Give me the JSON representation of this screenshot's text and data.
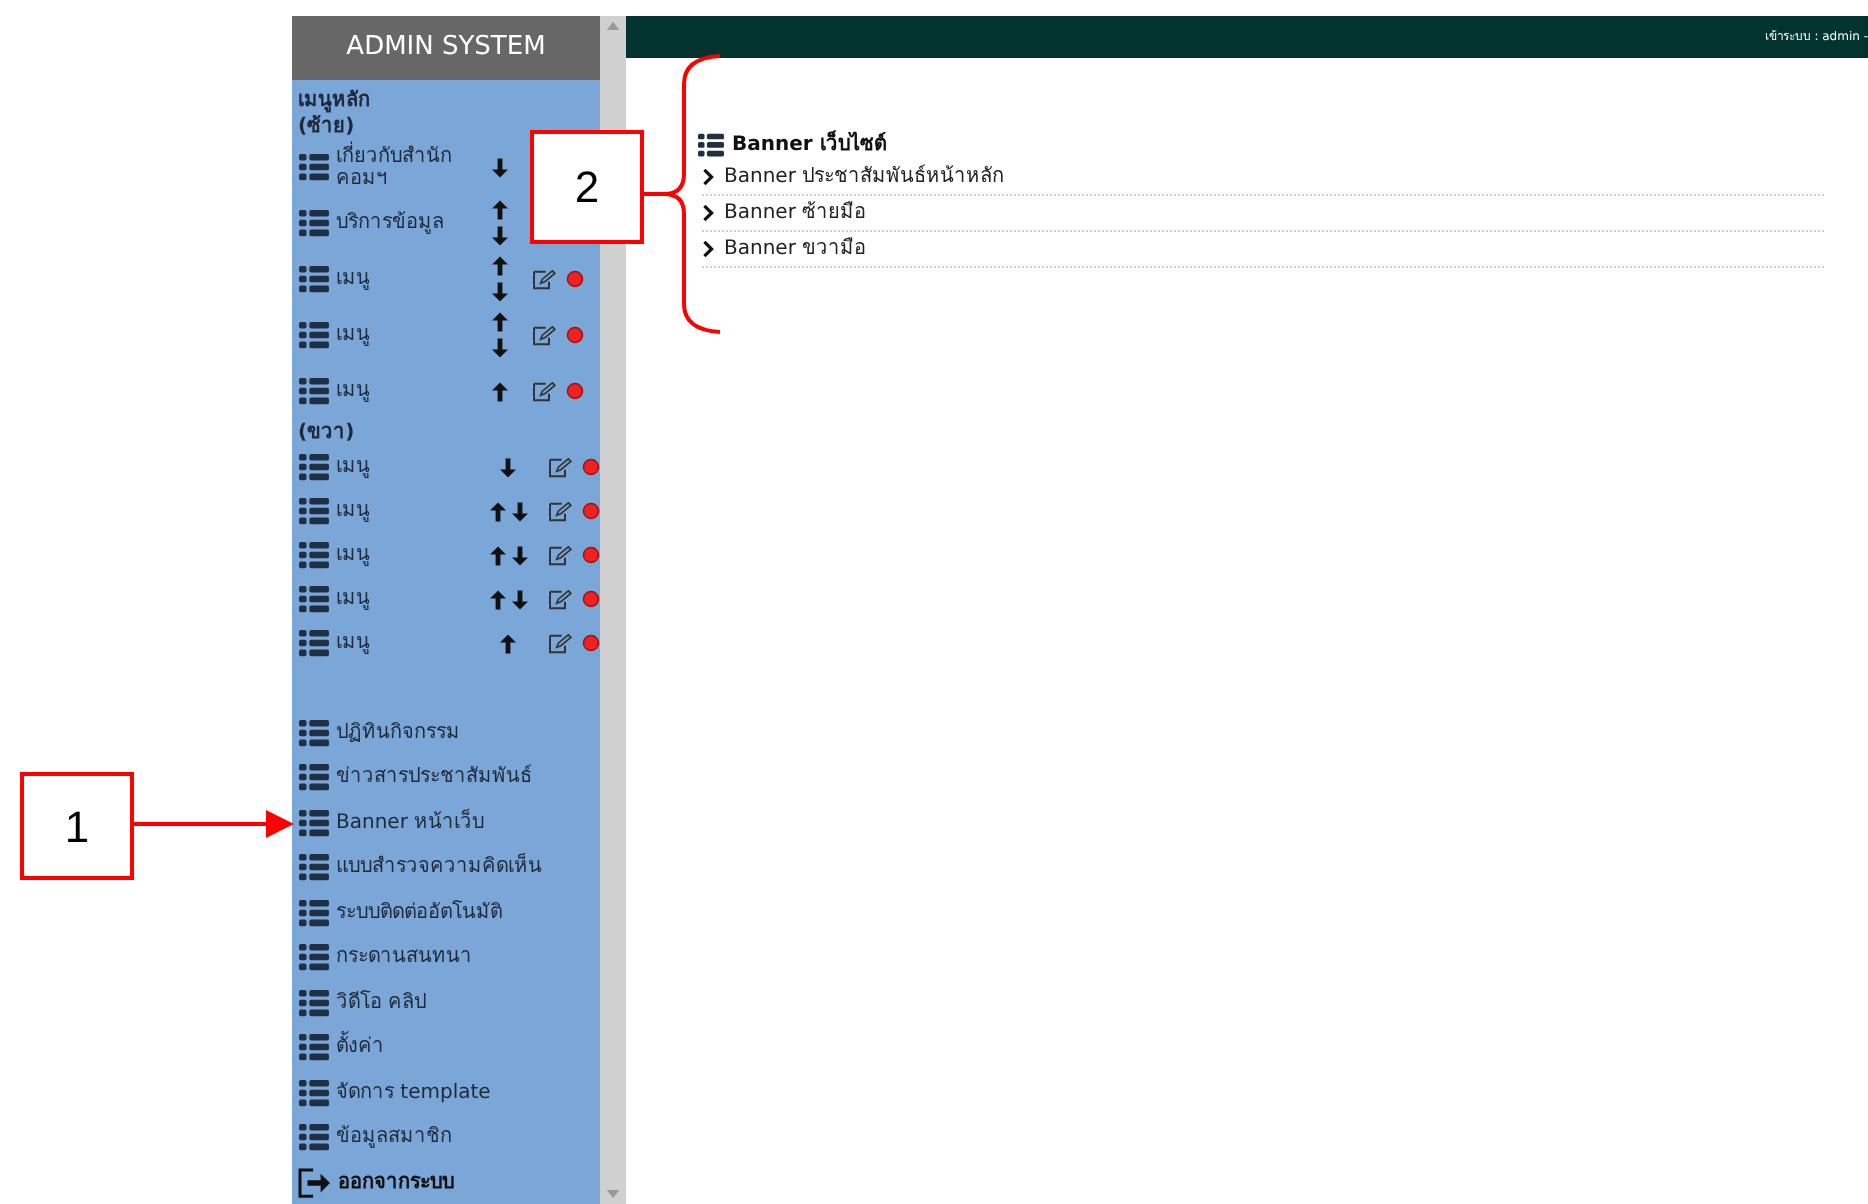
{
  "sidebar": {
    "title": "ADMIN SYSTEM",
    "menu_heading": "เมนูหลัก",
    "sections": [
      {
        "label": "(ซ้าย)",
        "kind": "stacked",
        "items": [
          {
            "label": "เกี่ยวกับสำนัก คอมฯ",
            "up": false,
            "down": true,
            "editable": false
          },
          {
            "label": "บริการข้อมูล",
            "up": true,
            "down": true,
            "editable": false
          },
          {
            "label": "เมนู",
            "up": true,
            "down": true,
            "editable": true
          },
          {
            "label": "เมนู",
            "up": true,
            "down": true,
            "editable": true
          },
          {
            "label": "เมนู",
            "up": true,
            "down": false,
            "editable": true
          }
        ]
      },
      {
        "label": "(ขวา)",
        "kind": "inline",
        "items": [
          {
            "label": "เมนู",
            "up": false,
            "down": true,
            "editable": true
          },
          {
            "label": "เมนู",
            "up": true,
            "down": true,
            "editable": true
          },
          {
            "label": "เมนู",
            "up": true,
            "down": true,
            "editable": true
          },
          {
            "label": "เมนู",
            "up": true,
            "down": true,
            "editable": true
          },
          {
            "label": "เมนู",
            "up": true,
            "down": false,
            "editable": true
          }
        ]
      }
    ],
    "links": [
      "ปฏิทินกิจกรรม",
      "ข่าวสารประชาสัมพันธ์",
      "Banner หน้าเว็บ",
      "แบบสำรวจความคิดเห็น",
      "ระบบติดต่ออัตโนมัติ",
      "กระดานสนทนา",
      "วิดีโอ คลิป",
      "ตั้งค่า",
      "จัดการ template",
      "ข้อมูลสมาชิก"
    ],
    "logout": "ออกจากระบบ"
  },
  "top_bar": {
    "login_text": "เข้าระบบ : admin -"
  },
  "content": {
    "title": "Banner เว็บไซต์",
    "links": [
      "Banner ประชาสัมพันธ์หน้าหลัก",
      "Banner ซ้ายมือ",
      "Banner ขวามือ"
    ]
  },
  "callouts": [
    {
      "number": "1"
    },
    {
      "number": "2"
    }
  ]
}
